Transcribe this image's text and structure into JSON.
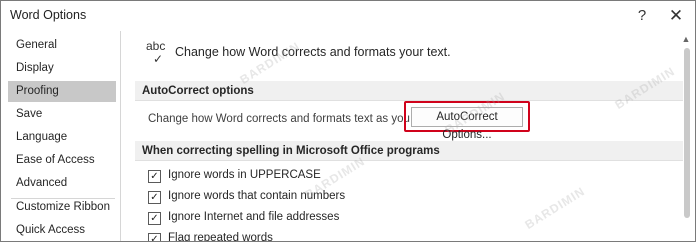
{
  "window": {
    "title": "Word Options"
  },
  "titlebar": {
    "help_glyph": "?",
    "close_glyph": "✕"
  },
  "sidebar": {
    "items": [
      {
        "label": "General",
        "selected": false
      },
      {
        "label": "Display",
        "selected": false
      },
      {
        "label": "Proofing",
        "selected": true
      },
      {
        "label": "Save",
        "selected": false
      },
      {
        "label": "Language",
        "selected": false
      },
      {
        "label": "Ease of Access",
        "selected": false
      },
      {
        "label": "Advanced",
        "selected": false
      },
      {
        "label": "Customize Ribbon",
        "selected": false
      },
      {
        "label": "Quick Access Toolbar",
        "selected": false
      }
    ]
  },
  "header": {
    "icon_text": "abc",
    "icon_check": "✓",
    "text": "Change how Word corrects and formats your text."
  },
  "autocorrect": {
    "section_title": "AutoCorrect options",
    "label": "Change how Word corrects and formats text as you type:",
    "button_label": "AutoCorrect Options..."
  },
  "spelling": {
    "section_title": "When correcting spelling in Microsoft Office programs",
    "options": [
      {
        "label": "Ignore words in UPPERCASE",
        "checked": true
      },
      {
        "label": "Ignore words that contain numbers",
        "checked": true
      },
      {
        "label": "Ignore Internet and file addresses",
        "checked": true
      },
      {
        "label": "Flag repeated words",
        "checked": true
      }
    ]
  },
  "watermark": {
    "text": "BARDIMIN"
  },
  "colors": {
    "highlight_border": "#d0021b",
    "selected_nav": "#c8c8c8",
    "section_bg": "#f0f0f0"
  }
}
